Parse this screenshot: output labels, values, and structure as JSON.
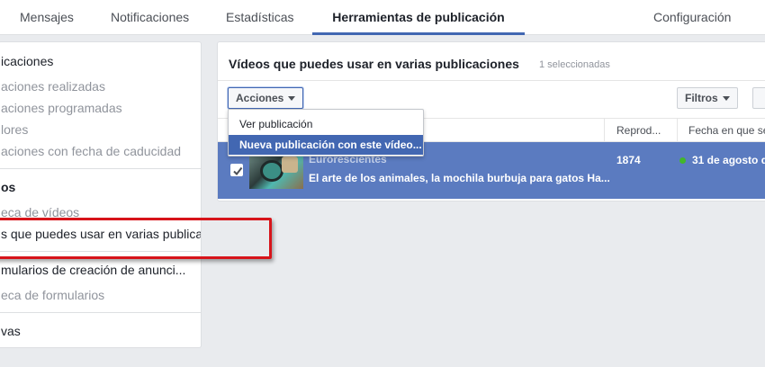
{
  "topnav": {
    "tabs": [
      {
        "label": "Mensajes"
      },
      {
        "label": "Notificaciones"
      },
      {
        "label": "Estadísticas"
      },
      {
        "label": "Herramientas de publicación"
      },
      {
        "label": "Configuración"
      }
    ],
    "active_tab": "Herramientas de publicación",
    "accent_color": "#4267b2"
  },
  "sidebar": {
    "items": [
      {
        "label": "icaciones",
        "style": "header"
      },
      {
        "label": "aciones realizadas",
        "style": "sub"
      },
      {
        "label": "aciones programadas",
        "style": "sub"
      },
      {
        "label": "lores",
        "style": "sub"
      },
      {
        "label": "aciones con fecha de caducidad",
        "style": "sub"
      },
      {
        "label": "os",
        "style": "section"
      },
      {
        "label": "eca de vídeos",
        "style": "sub"
      },
      {
        "label": "s que puedes usar en varias publicaciones",
        "style": "selected"
      },
      {
        "label": "mularios de creación de anunci...",
        "style": "sub"
      },
      {
        "label": "eca de formularios",
        "style": "sub"
      },
      {
        "label": "vas",
        "style": "sub"
      }
    ],
    "highlight_color": "#d7141a"
  },
  "main": {
    "title": "Vídeos que puedes usar en varias publicaciones",
    "selected_count": "1 seleccionadas",
    "actions_button": "Acciones",
    "filters_button": "Filtros",
    "columns": [
      "Reprod...",
      "Fecha en que se"
    ],
    "row": {
      "name": "Eurorescientes",
      "description": "El arte de los animales, la mochila burbuja para gatos Ha...",
      "views": "1874",
      "date": "31 de agosto d",
      "checked": true,
      "status_color": "#42b72a",
      "selected_color": "#5b7bc0"
    }
  },
  "dropdown": {
    "items": [
      {
        "label": "Ver publicación"
      },
      {
        "label": "Nueva publicación con este vídeo..."
      }
    ],
    "highlighted": "Nueva publicación con este vídeo..."
  }
}
